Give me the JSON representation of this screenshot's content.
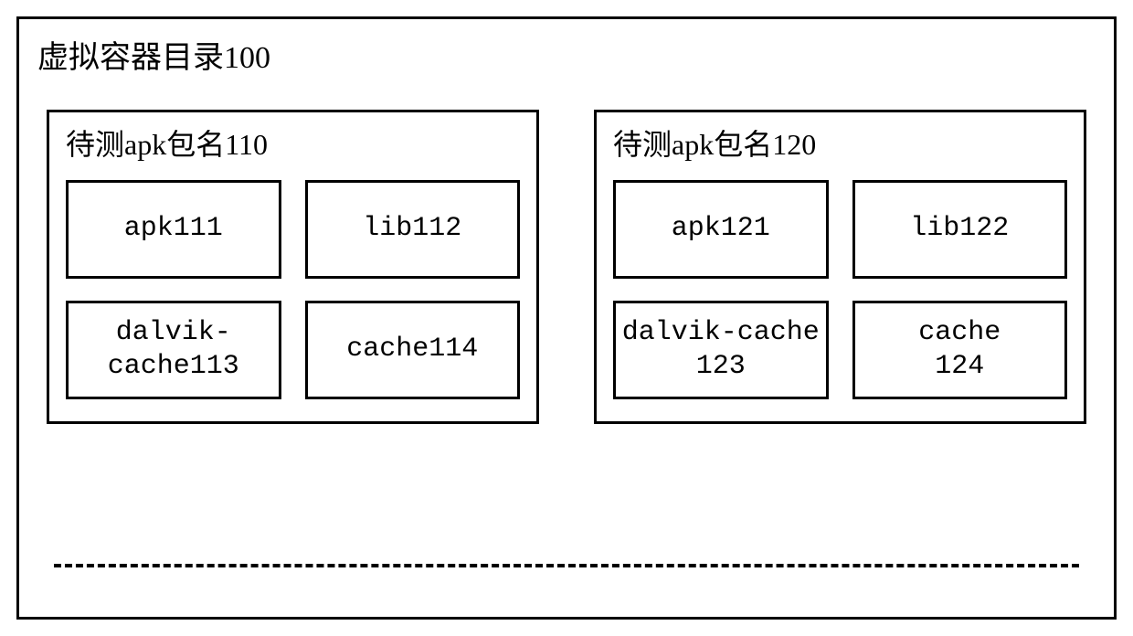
{
  "outer": {
    "title": "虚拟容器目录100"
  },
  "packages": [
    {
      "title": "待测apk包名110",
      "cells": [
        "apk111",
        "lib112",
        "dalvik-\ncache113",
        "cache114"
      ]
    },
    {
      "title": "待测apk包名120",
      "cells": [
        "apk121",
        "lib122",
        "dalvik-cache\n123",
        "cache\n124"
      ]
    }
  ]
}
